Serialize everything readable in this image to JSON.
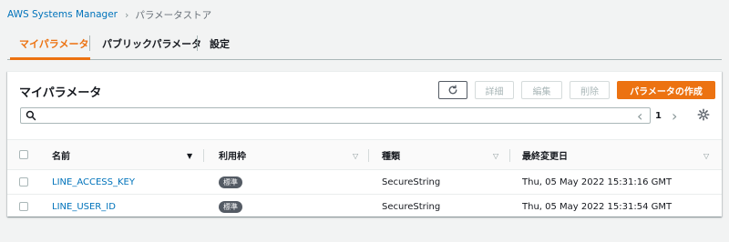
{
  "breadcrumb": {
    "root": "AWS Systems Manager",
    "separator": "›",
    "current": "パラメータストア"
  },
  "tabs": [
    {
      "label": "マイパラメータ",
      "active": true
    },
    {
      "label": "パブリックパラメータ",
      "active": false
    },
    {
      "label": "設定",
      "active": false
    }
  ],
  "panel": {
    "title": "マイパラメータ",
    "buttons": {
      "refresh_icon": "refresh-icon",
      "detail": "詳細",
      "edit": "編集",
      "delete": "削除",
      "create": "パラメータの作成"
    },
    "search": {
      "value": "",
      "placeholder": ""
    },
    "pagination": {
      "prev": "‹",
      "current_page": "1",
      "next": "›"
    }
  },
  "table": {
    "columns": [
      "名前",
      "利用枠",
      "種類",
      "最終変更日"
    ],
    "rows": [
      {
        "name": "LINE_ACCESS_KEY",
        "tier": "標準",
        "type": "SecureString",
        "modified": "Thu, 05 May 2022 15:31:16 GMT"
      },
      {
        "name": "LINE_USER_ID",
        "tier": "標準",
        "type": "SecureString",
        "modified": "Thu, 05 May 2022 15:31:54 GMT"
      }
    ]
  },
  "colors": {
    "accent": "#ec7211",
    "link": "#0073bb",
    "badge": "#545b64"
  }
}
